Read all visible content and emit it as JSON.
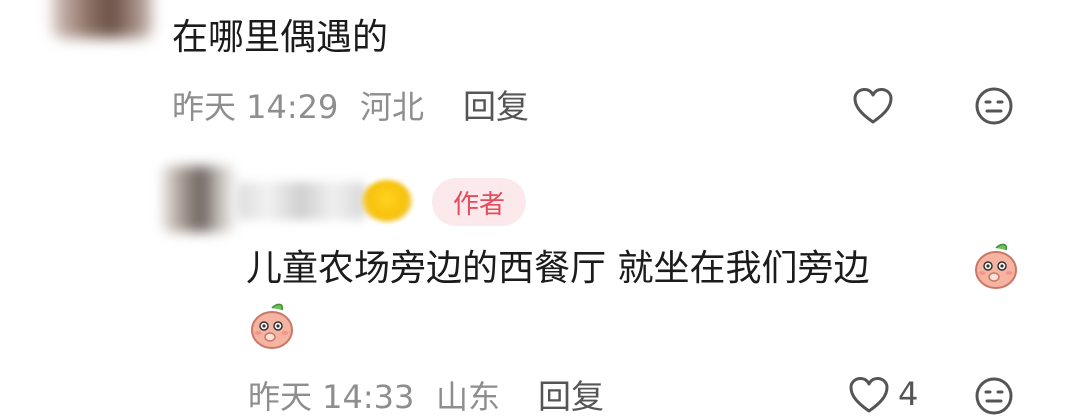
{
  "comments": [
    {
      "text": "在哪里偶遇的",
      "time": "昨天 14:29",
      "location": "河北",
      "reply_label": "回复"
    },
    {
      "author_badge": "作者",
      "text_line1": "儿童农场旁边的西餐厅 就坐在我们旁边",
      "time": "昨天 14:33",
      "location": "山东",
      "reply_label": "回复",
      "like_count": "4"
    }
  ],
  "icons": {
    "like": "heart-icon",
    "dislike": "meh-face-icon",
    "sticker": "peach-sticker-icon"
  },
  "colors": {
    "text": "#1b1b1b",
    "meta": "#8e8e8e",
    "badge_bg": "#fbe9ec",
    "badge_text": "#e64a5d"
  }
}
